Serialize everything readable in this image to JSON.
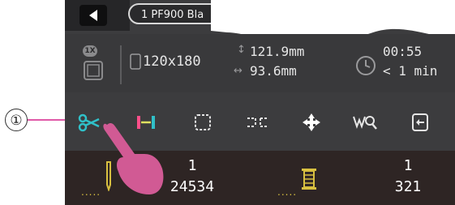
{
  "callout": {
    "number": "①"
  },
  "header": {
    "file_name": "1 PF900 Bla"
  },
  "info": {
    "hoop_size": "120x180",
    "height": "121.9mm",
    "width": "93.6mm",
    "time_total": "00:55",
    "time_next": "< 1 min",
    "badge": "1X"
  },
  "toolbar": {
    "icons": [
      "scissors-icon",
      "hoop-move-icon",
      "trial-frame-icon",
      "basting-icon",
      "center-move-icon",
      "search-icon",
      "exit-icon"
    ]
  },
  "counters": {
    "color_index": "1",
    "stitch_count": "24534",
    "thread_index": "1",
    "thread_total": "321"
  },
  "colors": {
    "accent_cyan": "#30c0c8",
    "pink": "#e05aa8",
    "thread_yellow": "#d8c040"
  }
}
